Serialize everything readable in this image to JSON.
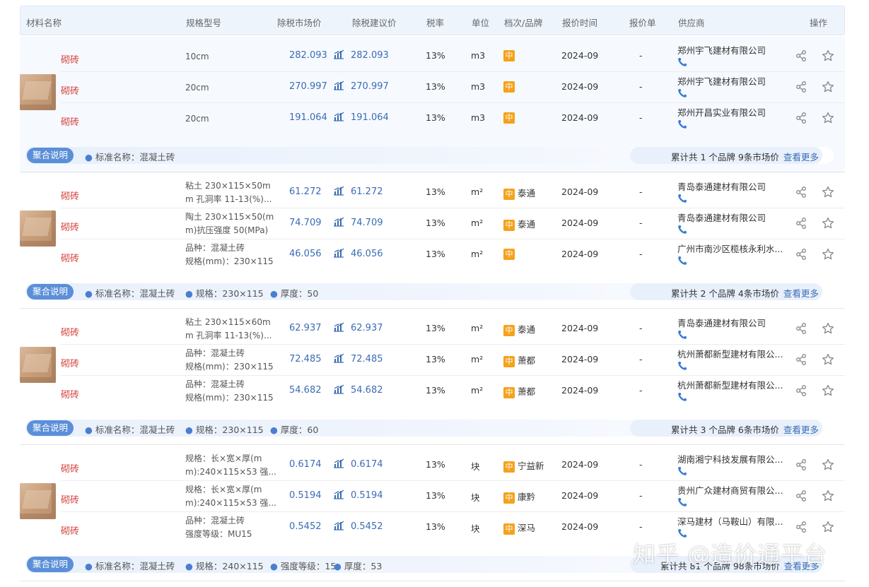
{
  "header": {
    "material_name": "材料名称",
    "spec": "规格型号",
    "market_price": "除税市场价",
    "suggested_price": "除税建议价",
    "tax_rate": "税率",
    "unit": "单位",
    "grade_brand": "档次/品牌",
    "quote_time": "报价时间",
    "quote_sheet": "报价单",
    "supplier": "供应商",
    "actions": "操作"
  },
  "grade_label": "中",
  "agg_label": "聚合说明",
  "more_label": "查看更多",
  "groups": [
    {
      "rows": [
        {
          "name": "砌砖",
          "spec1": "10cm",
          "spec2": "",
          "market": "282.093",
          "suggest": "282.093",
          "tax": "13%",
          "unit": "m3",
          "brand": "",
          "time": "2024-09",
          "quote": "-",
          "supplier": "郑州宇飞建材有限公司"
        },
        {
          "name": "砌砖",
          "spec1": "20cm",
          "spec2": "",
          "market": "270.997",
          "suggest": "270.997",
          "tax": "13%",
          "unit": "m3",
          "brand": "",
          "time": "2024-09",
          "quote": "-",
          "supplier": "郑州宇飞建材有限公司"
        },
        {
          "name": "砌砖",
          "spec1": "20cm",
          "spec2": "",
          "market": "191.064",
          "suggest": "191.064",
          "tax": "13%",
          "unit": "m3",
          "brand": "",
          "time": "2024-09",
          "quote": "-",
          "supplier": "郑州开昌实业有限公司"
        }
      ],
      "agg_items": [
        "标准名称：混凝土砖"
      ],
      "agg_total": "累计共 1 个品牌 9条市场价"
    },
    {
      "rows": [
        {
          "name": "砌砖",
          "spec1": "粘土 230×115×50m",
          "spec2": "m 孔洞率 11-13(%)...",
          "market": "61.272",
          "suggest": "61.272",
          "tax": "13%",
          "unit": "m²",
          "brand": "泰通",
          "time": "2024-09",
          "quote": "-",
          "supplier": "青岛泰通建材有限公司"
        },
        {
          "name": "砌砖",
          "spec1": "陶土 230×115×50(m",
          "spec2": "m)抗压强度 50(MPa)",
          "market": "74.709",
          "suggest": "74.709",
          "tax": "13%",
          "unit": "m²",
          "brand": "泰通",
          "time": "2024-09",
          "quote": "-",
          "supplier": "青岛泰通建材有限公司"
        },
        {
          "name": "砌砖",
          "spec1": "品种：混凝土砖",
          "spec2": "规格(mm)：230×115",
          "market": "46.056",
          "suggest": "46.056",
          "tax": "13%",
          "unit": "m²",
          "brand": "",
          "time": "2024-09",
          "quote": "-",
          "supplier": "广州市南沙区榄核永利水..."
        }
      ],
      "agg_items": [
        "标准名称：混凝土砖",
        "规格：230×115",
        "厚度：50"
      ],
      "agg_total": "累计共 2 个品牌 4条市场价"
    },
    {
      "rows": [
        {
          "name": "砌砖",
          "spec1": "粘土 230×115×60m",
          "spec2": "m 孔洞率 11-13(%)...",
          "market": "62.937",
          "suggest": "62.937",
          "tax": "13%",
          "unit": "m²",
          "brand": "泰通",
          "time": "2024-09",
          "quote": "-",
          "supplier": "青岛泰通建材有限公司"
        },
        {
          "name": "砌砖",
          "spec1": "品种：混凝土砖",
          "spec2": "规格(mm)：230×115",
          "market": "72.485",
          "suggest": "72.485",
          "tax": "13%",
          "unit": "m²",
          "brand": "萧都",
          "time": "2024-09",
          "quote": "-",
          "supplier": "杭州萧都新型建材有限公..."
        },
        {
          "name": "砌砖",
          "spec1": "品种：混凝土砖",
          "spec2": "规格(mm)：230×115",
          "market": "54.682",
          "suggest": "54.682",
          "tax": "13%",
          "unit": "m²",
          "brand": "萧都",
          "time": "2024-09",
          "quote": "-",
          "supplier": "杭州萧都新型建材有限公..."
        }
      ],
      "agg_items": [
        "标准名称：混凝土砖",
        "规格：230×115",
        "厚度：60"
      ],
      "agg_total": "累计共 3 个品牌 6条市场价"
    },
    {
      "rows": [
        {
          "name": "砌砖",
          "spec1": "规格：长×宽×厚(m",
          "spec2": "m):240×115×53 强...",
          "market": "0.6174",
          "suggest": "0.6174",
          "tax": "13%",
          "unit": "块",
          "brand": "宁益新",
          "time": "2024-09",
          "quote": "-",
          "supplier": "湖南湘宁科技发展有限公..."
        },
        {
          "name": "砌砖",
          "spec1": "规格：长×宽×厚(m",
          "spec2": "m):240×115×53 强...",
          "market": "0.5194",
          "suggest": "0.5194",
          "tax": "13%",
          "unit": "块",
          "brand": "康黔",
          "time": "2024-09",
          "quote": "-",
          "supplier": "贵州广众建材商贸有限公..."
        },
        {
          "name": "砌砖",
          "spec1": "品种：混凝土砖",
          "spec2": "强度等级：MU15",
          "market": "0.5452",
          "suggest": "0.5452",
          "tax": "13%",
          "unit": "块",
          "brand": "深马",
          "time": "2024-09",
          "quote": "-",
          "supplier": "深马建材（马鞍山）有限..."
        }
      ],
      "agg_items": [
        "标准名称：混凝土砖",
        "规格：240×115",
        "强度等级：15",
        "厚度：53"
      ],
      "agg_total": "累计共 81 个品牌 98条市场价"
    }
  ],
  "watermark": "知乎 @造价通平台",
  "colors": {
    "name_red": "#d43f3a",
    "price_blue": "#3a6cb4",
    "badge_orange": "#f4a21c",
    "agg_blue": "#5b8fd8"
  }
}
